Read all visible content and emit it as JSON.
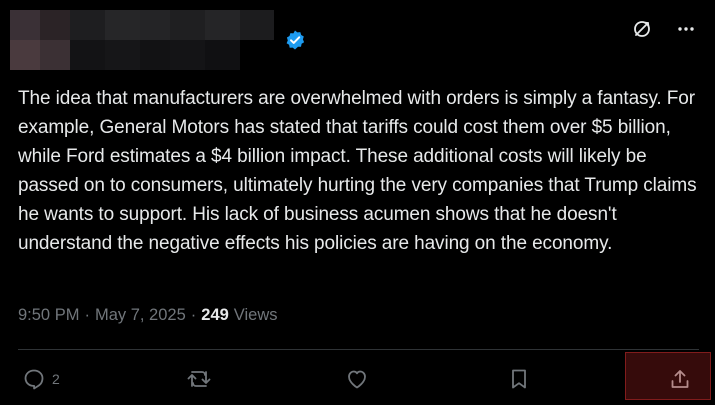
{
  "post": {
    "body": "The idea that manufacturers are overwhelmed with orders is simply a fantasy. For example, General Motors has stated that tariffs could cost them over $5 billion, while Ford estimates a $4 billion impact. These additional costs will likely be passed on to consumers, ultimately hurting the very companies that Trump claims he wants to support. His lack of business acumen shows that he doesn't understand the negative effects his policies are having on the economy.",
    "time": "9:50 PM",
    "date": "May 7, 2025",
    "views_count": "249",
    "views_label": "Views"
  },
  "actions": {
    "reply_count": "2"
  },
  "colors": {
    "background": "#000000",
    "text": "#e7e9ea",
    "muted": "#71767b",
    "verified": "#1d9bf0",
    "divider": "#2f3336"
  },
  "icons": {
    "verified": "verified-badge-icon",
    "grok": "grok-icon",
    "more": "more-icon",
    "reply": "reply-icon",
    "repost": "repost-icon",
    "like": "heart-icon",
    "bookmark": "bookmark-icon",
    "share": "share-icon"
  }
}
